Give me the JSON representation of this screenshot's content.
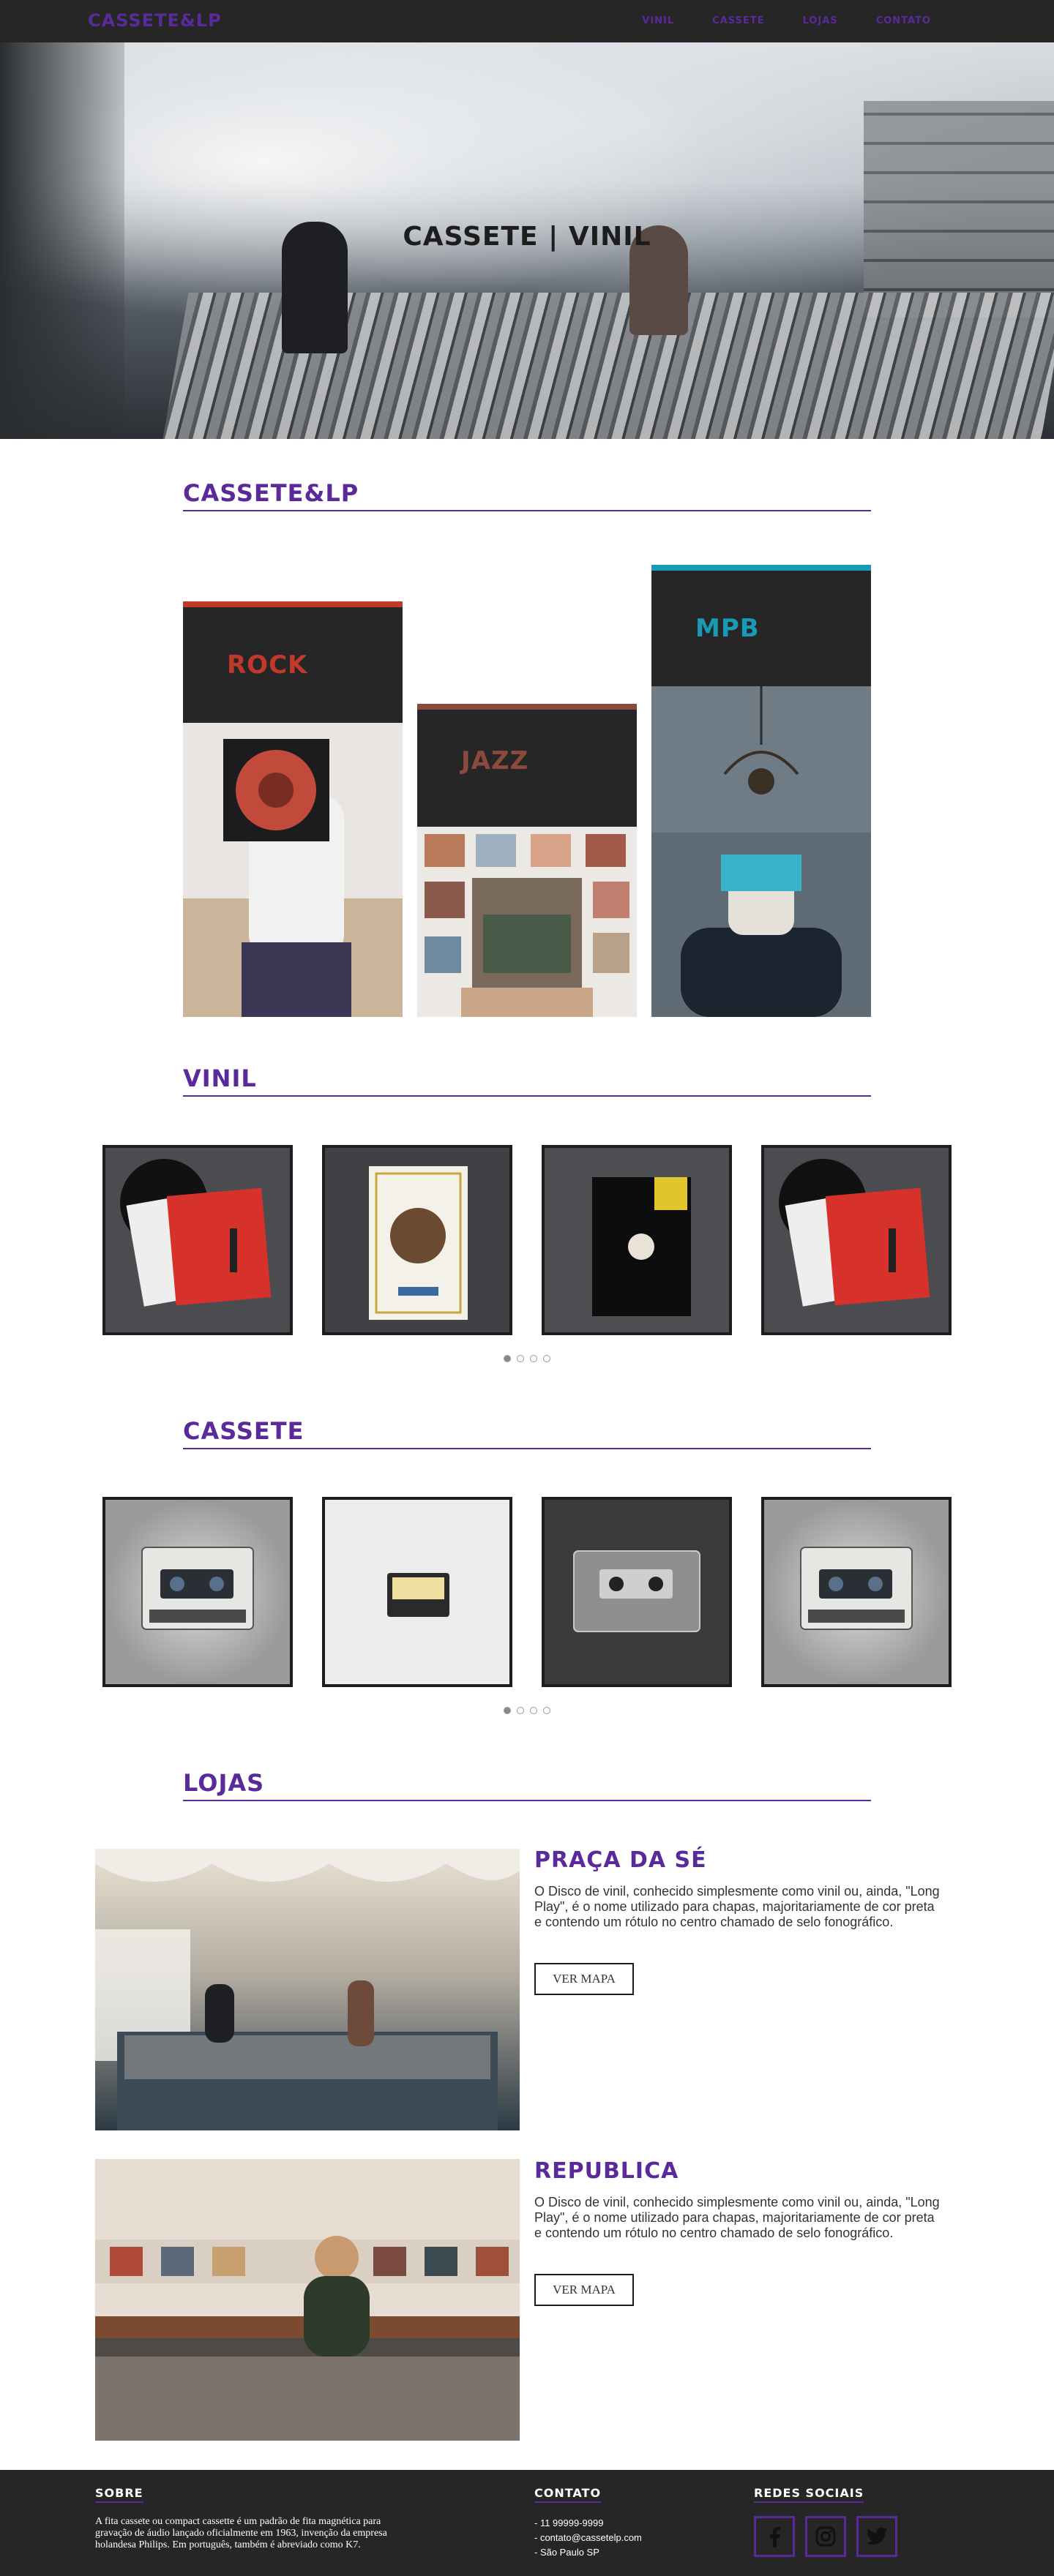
{
  "nav": {
    "logo": "CASSETE&LP",
    "links": [
      "VINIL",
      "CASSETE",
      "LOJAS",
      "CONTATO"
    ]
  },
  "hero": {
    "title": "CASSETE | VINIL"
  },
  "sections": {
    "about": "CASSETE&LP",
    "vinil": "VINIL",
    "cassete": "CASSETE",
    "lojas": "LOJAS"
  },
  "genres": [
    {
      "label": "ROCK",
      "color": "#c0392b"
    },
    {
      "label": "JAZZ",
      "color": "#8b4a3c"
    },
    {
      "label": "MPB",
      "color": "#1a9bb5"
    }
  ],
  "vinil_items": [
    "leon-bridges-record",
    "dr-dre-record",
    "black-record",
    "leon-bridges-record"
  ],
  "cassete_items": [
    "philips-cassette",
    "yellow-cassette",
    "clear-cassette",
    "philips-cassette"
  ],
  "stores": [
    {
      "name": "PRAÇA DA SÉ",
      "text": "O Disco de vinil, conhecido simplesmente como vinil ou, ainda, \"Long Play\", é o nome utilizado para chapas, majoritariamente de cor preta e contendo um rótulo no centro chamado de selo fonográfico.",
      "button": "VER MAPA"
    },
    {
      "name": "REPUBLICA",
      "text": "O Disco de vinil, conhecido simplesmente como vinil ou, ainda, \"Long Play\", é o nome utilizado para chapas, majoritariamente de cor preta e contendo um rótulo no centro chamado de selo fonográfico.",
      "button": "VER MAPA"
    }
  ],
  "footer": {
    "about_title": "SOBRE",
    "about_text": "A fita cassete ou compact cassette é um padrão de fita magnética para gravação de áudio lançado oficialmente em 1963, invenção da empresa holandesa Philips. Em português, também é abreviado como K7.",
    "contact_title": "CONTATO",
    "contact_lines": [
      "- 11 99999-9999",
      "- contato@cassetelp.com",
      "- São Paulo SP"
    ],
    "social_title": "REDES SOCIAIS",
    "social_icons": [
      "facebook-icon",
      "instagram-icon",
      "twitter-icon"
    ]
  },
  "colors": {
    "accent": "#5b2a9a",
    "dark": "#262626"
  }
}
